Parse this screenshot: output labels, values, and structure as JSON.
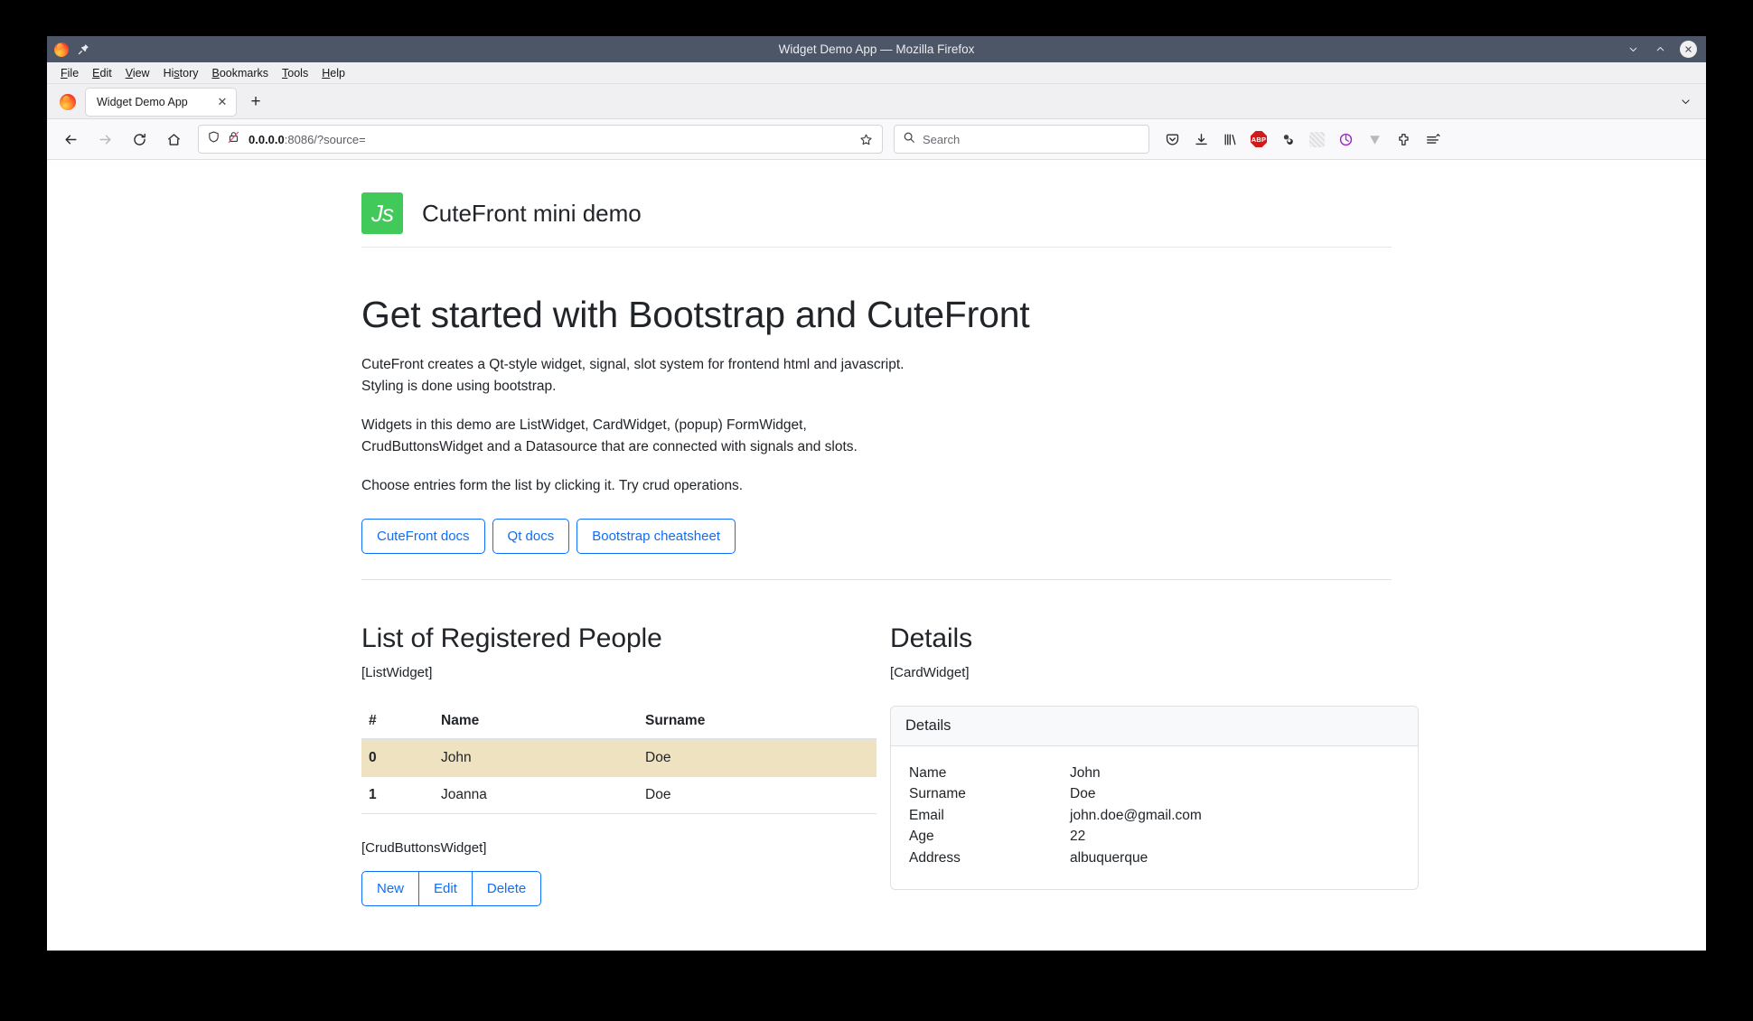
{
  "window": {
    "title": "Widget Demo App — Mozilla Firefox",
    "controls": {
      "minimize": "minimize",
      "maximize": "maximize",
      "close": "close"
    },
    "pin_icon": "pin-icon",
    "app_icon": "firefox-logo"
  },
  "menubar": {
    "items": [
      {
        "label": "File",
        "mnemonic": "F"
      },
      {
        "label": "Edit",
        "mnemonic": "E"
      },
      {
        "label": "View",
        "mnemonic": "V"
      },
      {
        "label": "History",
        "mnemonic": "s"
      },
      {
        "label": "Bookmarks",
        "mnemonic": "B"
      },
      {
        "label": "Tools",
        "mnemonic": "T"
      },
      {
        "label": "Help",
        "mnemonic": "H"
      }
    ]
  },
  "tabs": {
    "active_tab_title": "Widget Demo App",
    "close_glyph": "✕",
    "newtab_glyph": "+",
    "list_all_tabs": "chevron-down-icon"
  },
  "navbar": {
    "back": "back-icon",
    "forward": "forward-icon",
    "reload": "reload-icon",
    "home": "home-icon",
    "url_host": "0.0.0.0",
    "url_rest": ":8086/?source=",
    "shield": "shield-icon",
    "lock": "lock-crossed-icon",
    "bookmark": "star-icon",
    "search_placeholder": "Search",
    "search_icon": "search-icon",
    "tool_icons": [
      "pocket-icon",
      "downloads-icon",
      "library-icon",
      "adblock-plus-icon",
      "privacy-badger-icon",
      "ghostery-icon",
      "cookie-autodelete-icon",
      "video-downloader-icon",
      "extensions-icon",
      "app-menu-icon"
    ],
    "adblock_label": "ABP"
  },
  "page": {
    "brand": {
      "logo_text": "Js",
      "title": "CuteFront mini demo",
      "logo_color": "#41c95a"
    },
    "hero": {
      "heading": "Get started with Bootstrap and CuteFront",
      "paragraph1": "CuteFront creates a Qt-style widget, signal, slot system for frontend html and javascript. Styling is done using bootstrap.",
      "paragraph2": "Widgets in this demo are ListWidget, CardWidget, (popup) FormWidget, CrudButtonsWidget and a Datasource that are connected with signals and slots.",
      "paragraph3": "Choose entries form the list by clicking it. Try crud operations.",
      "buttons": [
        {
          "label": "CuteFront docs"
        },
        {
          "label": "Qt docs"
        },
        {
          "label": "Bootstrap cheatsheet"
        }
      ]
    },
    "list_section": {
      "title": "List of Registered People",
      "widget_tag": "[ListWidget]",
      "columns": [
        "#",
        "Name",
        "Surname"
      ],
      "rows": [
        {
          "index": "0",
          "name": "John",
          "surname": "Doe",
          "selected": true
        },
        {
          "index": "1",
          "name": "Joanna",
          "surname": "Doe",
          "selected": false
        }
      ],
      "crud_tag": "[CrudButtonsWidget]",
      "crud_buttons": [
        {
          "label": "New"
        },
        {
          "label": "Edit"
        },
        {
          "label": "Delete"
        }
      ]
    },
    "details_section": {
      "title": "Details",
      "widget_tag": "[CardWidget]",
      "card_header": "Details",
      "fields": [
        {
          "key": "Name",
          "value": "John"
        },
        {
          "key": "Surname",
          "value": "Doe"
        },
        {
          "key": "Email",
          "value": "john.doe@gmail.com"
        },
        {
          "key": "Age",
          "value": "22"
        },
        {
          "key": "Address",
          "value": "albuquerque"
        }
      ]
    }
  },
  "colors": {
    "accent": "#0d6efd",
    "selected_row": "#efe2c1",
    "titlebar": "#4d5666",
    "js_green": "#41c95a"
  }
}
